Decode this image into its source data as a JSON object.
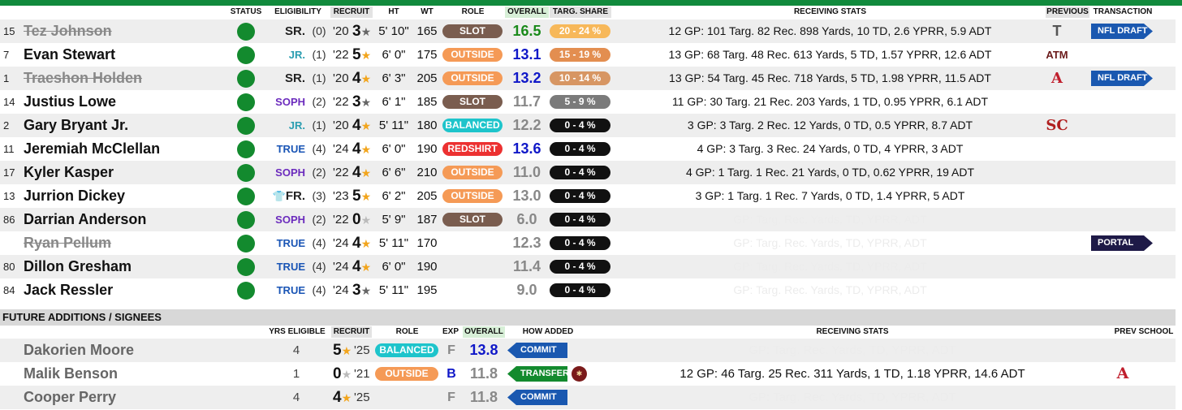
{
  "colors": {
    "accent_green": "#118a3c",
    "status_green": "#138a2e",
    "overall_green": "#1a8a1a",
    "overall_blue": "#1018c8",
    "overall_gray": "#888888",
    "transfer_green": "#138a2e",
    "commit_blue": "#1a58b0"
  },
  "headers": {
    "status": "STATUS",
    "eligibility": "ELIGIBILITY",
    "recruit": "RECRUIT",
    "ht": "HT",
    "wt": "WT",
    "role": "ROLE",
    "overall": "OVERALL",
    "targ_share": "TARG. SHARE",
    "receiving_stats": "RECEIVING STATS",
    "previous": "PREVIOUS",
    "transaction": "TRANSACTION"
  },
  "roster": [
    {
      "number": "15",
      "name": "Tez Johnson",
      "struck": true,
      "eligibility": "SR.",
      "elig_class": "sr",
      "yrs": "(0)",
      "recruit_year": "'20",
      "stars": "3",
      "star_color": "gray",
      "ht": "5' 10\"",
      "wt": "165",
      "role": "SLOT",
      "role_class": "slot",
      "overall": "16.5",
      "overall_color": "green",
      "share": "20 - 24 %",
      "share_class": "yellow",
      "stats": "12 GP: 101 Targ. 82 Rec. 898 Yards, 10 TD, 2.6 YPRR, 5.9 ADT",
      "stats_faint": false,
      "previous": "T",
      "previous_icon": "troy-logo-icon",
      "transaction": "NFL DRAFT",
      "transaction_class": "blue"
    },
    {
      "number": "7",
      "name": "Evan Stewart",
      "struck": false,
      "eligibility": "JR.",
      "elig_class": "jr",
      "yrs": "(1)",
      "recruit_year": "'22",
      "stars": "5",
      "star_color": "gold",
      "ht": "6' 0\"",
      "wt": "175",
      "role": "OUTSIDE",
      "role_class": "outside",
      "overall": "13.1",
      "overall_color": "blue",
      "share": "15 - 19 %",
      "share_class": "orange",
      "stats": "13 GP: 68 Targ. 48 Rec. 613 Yards, 5 TD, 1.57 YPRR, 12.6 ADT",
      "stats_faint": false,
      "previous": "ATM",
      "previous_icon": "texas-am-logo-icon",
      "transaction": "",
      "transaction_class": ""
    },
    {
      "number": "1",
      "name": "Traeshon Holden",
      "struck": true,
      "eligibility": "SR.",
      "elig_class": "sr",
      "yrs": "(1)",
      "recruit_year": "'20",
      "stars": "4",
      "star_color": "gold",
      "ht": "6' 3\"",
      "wt": "205",
      "role": "OUTSIDE",
      "role_class": "outside",
      "overall": "13.2",
      "overall_color": "blue",
      "share": "10 - 14 %",
      "share_class": "brown",
      "stats": "13 GP: 54 Targ. 45 Rec. 718 Yards, 5 TD, 1.98 YPRR, 11.5 ADT",
      "stats_faint": false,
      "previous": "A",
      "previous_icon": "alabama-logo-icon",
      "transaction": "NFL DRAFT",
      "transaction_class": "blue"
    },
    {
      "number": "14",
      "name": "Justius Lowe",
      "struck": false,
      "eligibility": "SOPH",
      "elig_class": "soph",
      "yrs": "(2)",
      "recruit_year": "'22",
      "stars": "3",
      "star_color": "gray",
      "ht": "6' 1\"",
      "wt": "185",
      "role": "SLOT",
      "role_class": "slot",
      "overall": "11.7",
      "overall_color": "gray",
      "share": "5 - 9 %",
      "share_class": "gray",
      "stats": "11 GP: 30 Targ. 21 Rec. 203 Yards, 1 TD, 0.95 YPRR, 6.1 ADT",
      "stats_faint": false,
      "previous": "",
      "previous_icon": "",
      "transaction": "",
      "transaction_class": ""
    },
    {
      "number": "2",
      "name": "Gary Bryant Jr.",
      "struck": false,
      "eligibility": "JR.",
      "elig_class": "jr",
      "yrs": "(1)",
      "recruit_year": "'20",
      "stars": "4",
      "star_color": "gold",
      "ht": "5' 11\"",
      "wt": "180",
      "role": "BALANCED",
      "role_class": "balanced",
      "overall": "12.2",
      "overall_color": "gray",
      "share": "0 - 4 %",
      "share_class": "black",
      "stats": "3 GP: 3 Targ. 2 Rec. 12 Yards, 0 TD, 0.5 YPRR, 8.7 ADT",
      "stats_faint": false,
      "previous": "SC",
      "previous_icon": "usc-logo-icon",
      "transaction": "",
      "transaction_class": ""
    },
    {
      "number": "11",
      "name": "Jeremiah McClellan",
      "struck": false,
      "eligibility": "TRUE",
      "elig_class": "true",
      "yrs": "(4)",
      "recruit_year": "'24",
      "stars": "4",
      "star_color": "gold",
      "ht": "6' 0\"",
      "wt": "190",
      "role": "REDSHIRT",
      "role_class": "redshirt",
      "overall": "13.6",
      "overall_color": "blue",
      "share": "0 - 4 %",
      "share_class": "black",
      "stats": "4 GP: 3 Targ. 3 Rec. 24 Yards, 0 TD, 4 YPRR, 3 ADT",
      "stats_faint": false,
      "previous": "",
      "previous_icon": "",
      "transaction": "",
      "transaction_class": ""
    },
    {
      "number": "17",
      "name": "Kyler Kasper",
      "struck": false,
      "eligibility": "SOPH",
      "elig_class": "soph",
      "yrs": "(2)",
      "recruit_year": "'22",
      "stars": "4",
      "star_color": "gold",
      "ht": "6' 6\"",
      "wt": "210",
      "role": "OUTSIDE",
      "role_class": "outside",
      "overall": "11.0",
      "overall_color": "gray",
      "share": "0 - 4 %",
      "share_class": "black",
      "stats": "4 GP: 1 Targ. 1 Rec. 21 Yards, 0 TD, 0.62 YPRR, 19 ADT",
      "stats_faint": false,
      "previous": "",
      "previous_icon": "",
      "transaction": "",
      "transaction_class": ""
    },
    {
      "number": "13",
      "name": "Jurrion Dickey",
      "struck": false,
      "eligibility": "FR.",
      "elig_class": "fr",
      "redshirt_icon": "👕",
      "yrs": "(3)",
      "recruit_year": "'23",
      "stars": "5",
      "star_color": "gold",
      "ht": "6' 2\"",
      "wt": "205",
      "role": "OUTSIDE",
      "role_class": "outside",
      "overall": "13.0",
      "overall_color": "gray",
      "share": "0 - 4 %",
      "share_class": "black",
      "stats": "3 GP: 1 Targ. 1 Rec. 7 Yards, 0 TD, 1.4 YPRR, 5 ADT",
      "stats_faint": false,
      "previous": "",
      "previous_icon": "",
      "transaction": "",
      "transaction_class": ""
    },
    {
      "number": "86",
      "name": "Darrian Anderson",
      "struck": false,
      "eligibility": "SOPH",
      "elig_class": "soph",
      "yrs": "(2)",
      "recruit_year": "'22",
      "stars": "0",
      "star_color": "lgray",
      "ht": "5' 9\"",
      "wt": "187",
      "role": "SLOT",
      "role_class": "slot",
      "overall": "6.0",
      "overall_color": "gray",
      "share": "0 - 4 %",
      "share_class": "black",
      "stats": "GP: Targ. Rec. Yards, TD, YPRR, ADT",
      "stats_faint": true,
      "previous": "",
      "previous_icon": "",
      "transaction": "",
      "transaction_class": ""
    },
    {
      "number": "",
      "name": "Ryan Pellum",
      "struck": true,
      "eligibility": "TRUE",
      "elig_class": "true",
      "yrs": "(4)",
      "recruit_year": "'24",
      "stars": "4",
      "star_color": "gold",
      "ht": "5' 11\"",
      "wt": "170",
      "role": "",
      "role_class": "",
      "overall": "12.3",
      "overall_color": "gray",
      "share": "0 - 4 %",
      "share_class": "black",
      "stats": "GP: Targ. Rec. Yards, TD, YPRR, ADT",
      "stats_faint": true,
      "previous": "",
      "previous_icon": "",
      "transaction": "PORTAL",
      "transaction_class": "navy"
    },
    {
      "number": "80",
      "name": "Dillon Gresham",
      "struck": false,
      "eligibility": "TRUE",
      "elig_class": "true",
      "yrs": "(4)",
      "recruit_year": "'24",
      "stars": "4",
      "star_color": "gold",
      "ht": "6' 0\"",
      "wt": "190",
      "role": "",
      "role_class": "",
      "overall": "11.4",
      "overall_color": "gray",
      "share": "0 - 4 %",
      "share_class": "black",
      "stats": "GP: Targ. Rec. Yards, TD, YPRR, ADT",
      "stats_faint": true,
      "previous": "",
      "previous_icon": "",
      "transaction": "",
      "transaction_class": ""
    },
    {
      "number": "84",
      "name": "Jack Ressler",
      "struck": false,
      "eligibility": "TRUE",
      "elig_class": "true",
      "yrs": "(4)",
      "recruit_year": "'24",
      "stars": "3",
      "star_color": "gray",
      "ht": "5' 11\"",
      "wt": "195",
      "role": "",
      "role_class": "",
      "overall": "9.0",
      "overall_color": "gray",
      "share": "0 - 4 %",
      "share_class": "black",
      "stats": "GP: Targ. Rec. Yards, TD, YPRR, ADT",
      "stats_faint": true,
      "previous": "",
      "previous_icon": "",
      "transaction": "",
      "transaction_class": ""
    }
  ],
  "future": {
    "section_title": "FUTURE ADDITIONS / SIGNEES",
    "headers": {
      "yrs_eligible": "YRS ELIGIBLE",
      "recruit": "RECRUIT",
      "role": "ROLE",
      "exp": "EXP",
      "overall": "OVERALL",
      "how_added": "HOW ADDED",
      "receiving_stats": "RECEIVING STATS",
      "prev_school": "PREV SCHOOL"
    },
    "rows": [
      {
        "name": "Dakorien Moore",
        "yrs": "4",
        "stars": "5",
        "star_color": "gold",
        "year": "'25",
        "role": "BALANCED",
        "role_class": "balanced",
        "exp": "F",
        "exp_color": "#888888",
        "overall": "13.8",
        "overall_color": "blue",
        "how_added": "COMMIT",
        "how_class": "blue",
        "stats": "GP: Targ. Rec. Yards, TD, YPRR, ADT",
        "stats_faint": true,
        "school_icon": "",
        "prev_school": ""
      },
      {
        "name": "Malik Benson",
        "yrs": "1",
        "stars": "0",
        "star_color": "lgray",
        "year": "'21",
        "role": "OUTSIDE",
        "role_class": "outside",
        "exp": "B",
        "exp_color": "#1018c8",
        "overall": "11.8",
        "overall_color": "gray",
        "how_added": "TRANSFER",
        "how_class": "green",
        "stats": "12 GP: 46 Targ. 25 Rec. 311 Yards, 1 TD, 1.18 YPRR, 14.6 ADT",
        "stats_faint": false,
        "school_icon": "florida-state-logo-icon",
        "prev_school": "A",
        "prev_school_icon": "alabama-logo-icon"
      },
      {
        "name": "Cooper Perry",
        "yrs": "4",
        "stars": "4",
        "star_color": "gold",
        "year": "'25",
        "role": "",
        "role_class": "",
        "exp": "F",
        "exp_color": "#888888",
        "overall": "11.8",
        "overall_color": "gray",
        "how_added": "COMMIT",
        "how_class": "blue",
        "stats": "GP: Targ. Rec. Yards, TD, YPRR, ADT",
        "stats_faint": true,
        "school_icon": "",
        "prev_school": ""
      }
    ]
  }
}
